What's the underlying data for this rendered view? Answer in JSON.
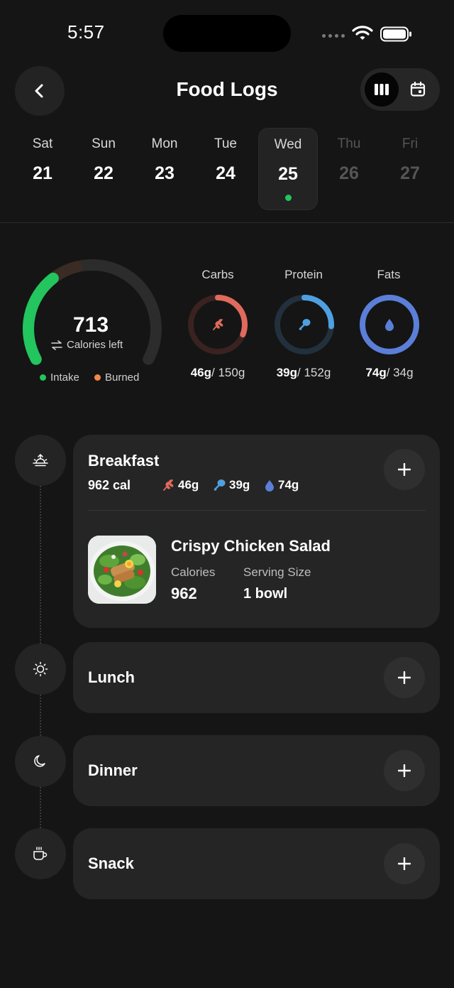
{
  "status_bar": {
    "time": "5:57"
  },
  "header": {
    "title": "Food Logs"
  },
  "week": [
    {
      "name": "Sat",
      "num": "21"
    },
    {
      "name": "Sun",
      "num": "22"
    },
    {
      "name": "Mon",
      "num": "23"
    },
    {
      "name": "Tue",
      "num": "24"
    },
    {
      "name": "Wed",
      "num": "25"
    },
    {
      "name": "Thu",
      "num": "26"
    },
    {
      "name": "Fri",
      "num": "27"
    }
  ],
  "summary": {
    "calories_left": "713",
    "calories_label": "Calories left",
    "intake_progress": 0.34,
    "legend": {
      "intake": "Intake",
      "burned": "Burned"
    },
    "macros": [
      {
        "name": "Carbs",
        "consumed": "46g",
        "goal": "/ 150g",
        "progress": 0.31,
        "color": "#e06a5d",
        "icon": "wheat-icon"
      },
      {
        "name": "Protein",
        "consumed": "39g",
        "goal": "/ 152g",
        "progress": 0.26,
        "color": "#4ea0e0",
        "icon": "drumstick-icon"
      },
      {
        "name": "Fats",
        "consumed": "74g",
        "goal": "/ 34g",
        "progress": 1.0,
        "color": "#5b7fd8",
        "icon": "drop-icon"
      }
    ],
    "colors": {
      "intake": "#22c55e",
      "burned": "#f08a4b"
    }
  },
  "meals": {
    "breakfast": {
      "title": "Breakfast",
      "calories": "962 cal",
      "carbs": "46g",
      "protein": "39g",
      "fats": "74g",
      "item": {
        "name": "Crispy Chicken Salad",
        "calories_label": "Calories",
        "calories_value": "962",
        "serving_label": "Serving Size",
        "serving_value": "1 bowl"
      }
    },
    "lunch": {
      "title": "Lunch"
    },
    "dinner": {
      "title": "Dinner"
    },
    "snack": {
      "title": "Snack"
    }
  }
}
